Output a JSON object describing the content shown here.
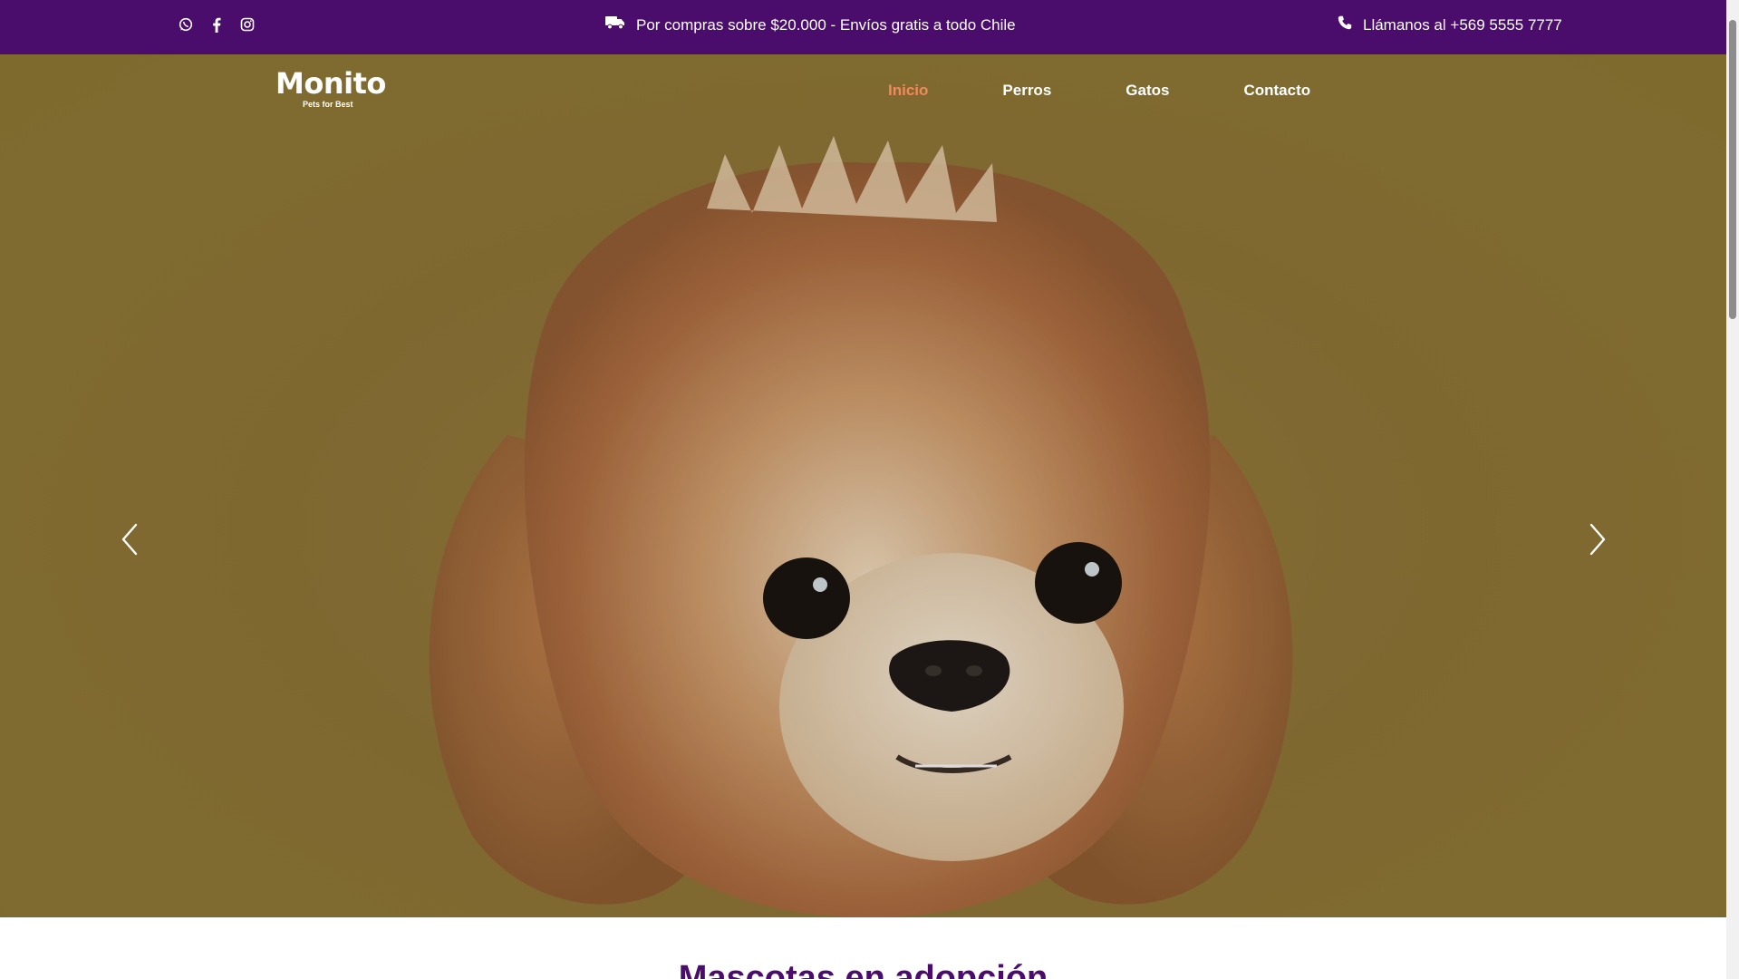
{
  "topbar": {
    "social_icons": [
      "whatsapp-icon",
      "facebook-icon",
      "instagram-icon"
    ],
    "promo_text": "Por compras sobre $20.000 - Envíos gratis a todo Chile",
    "phone_text": "Llámanos al +569 5555 7777",
    "bg_color": "#4b0d6b"
  },
  "header": {
    "logo_word": "Monito",
    "logo_tagline": "Pets for Best",
    "nav": [
      {
        "label": "Inicio",
        "active": true
      },
      {
        "label": "Perros",
        "active": false
      },
      {
        "label": "Gatos",
        "active": false
      },
      {
        "label": "Contacto",
        "active": false
      }
    ],
    "active_color": "#f08a5d"
  },
  "carousel": {
    "prev_icon": "chevron-left-icon",
    "next_icon": "chevron-right-icon"
  },
  "section": {
    "title": "Mascotas en adopción"
  }
}
